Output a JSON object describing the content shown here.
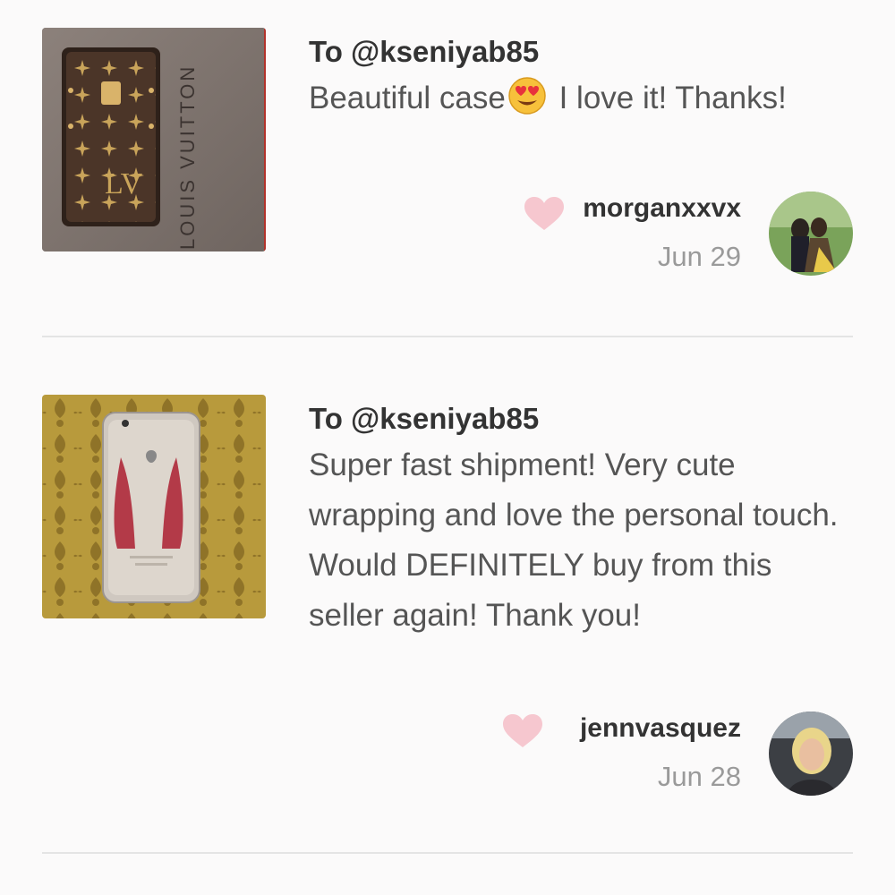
{
  "reviews": [
    {
      "to_line": "To @kseniyab85",
      "message_before_emoji": "Beautiful case",
      "emoji_icon": "heart-eyes-emoji-icon",
      "message_after_emoji": " I love it! Thanks!",
      "username": "morganxxvx",
      "date": "Jun 29",
      "thumbnail_brand_text": "LOUIS VUITTON"
    },
    {
      "to_line": "To @kseniyab85",
      "message": "Super fast shipment! Very cute wrapping and love the personal touch. Would DEFINITELY buy from this seller again! Thank you!",
      "username": "jennvasquez",
      "date": "Jun 28"
    }
  ],
  "colors": {
    "background": "#fbfafa",
    "heart": "#f6c7cf",
    "divider": "#e4e4e4",
    "date_text": "#9a9a9a"
  }
}
